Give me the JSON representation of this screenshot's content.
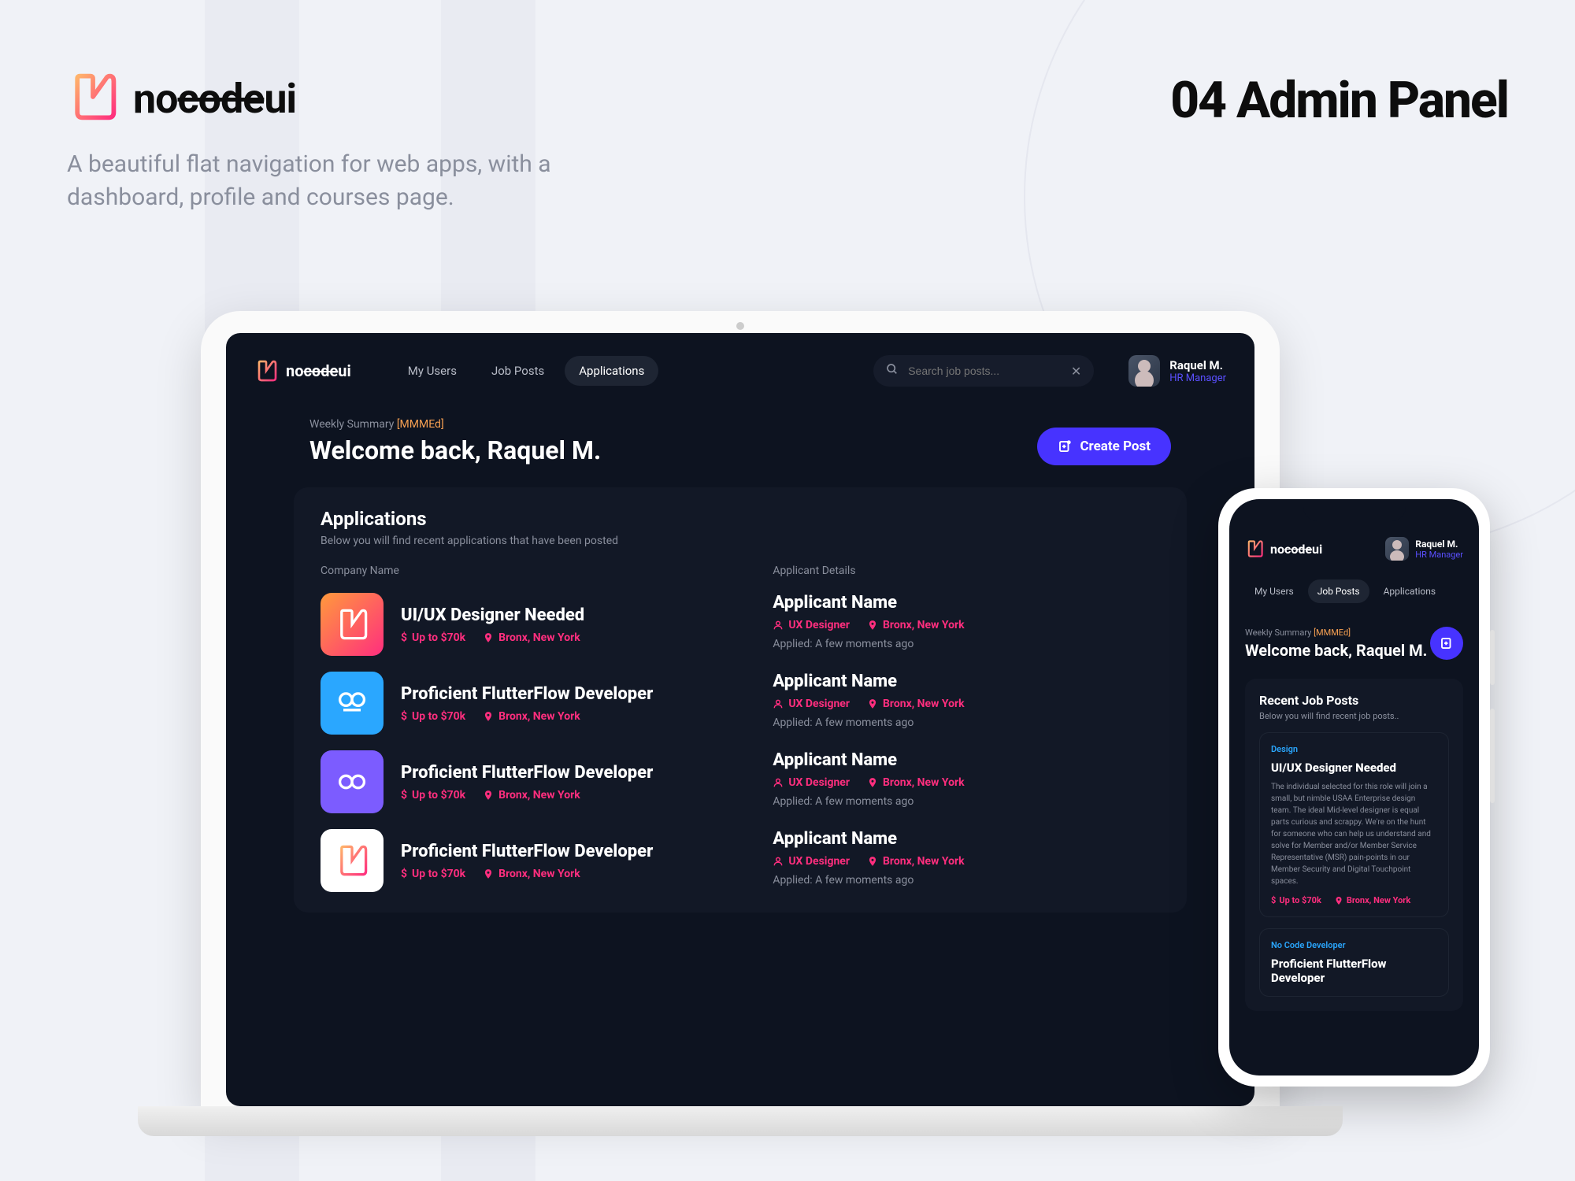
{
  "page": {
    "brand": "nocodeui",
    "tagline": "A beautiful flat navigation for web apps, with a dashboard, profile and courses page.",
    "big_title": "04 Admin Panel"
  },
  "laptop": {
    "brand": "nocodeui",
    "nav": [
      "My Users",
      "Job Posts",
      "Applications"
    ],
    "active_nav_index": 2,
    "search_placeholder": "Search job posts...",
    "user": {
      "name": "Raquel M.",
      "role": "HR Manager"
    },
    "summary_label": "Weekly Summary",
    "summary_tag": "[MMMEd]",
    "welcome": "Welcome back, Raquel M.",
    "create_btn": "Create Post",
    "panel": {
      "title": "Applications",
      "subtitle": "Below you will find recent applications that have been posted",
      "col_left": "Company Name",
      "col_right": "Applicant Details"
    },
    "rows": [
      {
        "tile": "gradient",
        "title": "UI/UX Designer Needed",
        "salary": "Up to $70k",
        "location": "Bronx, New York",
        "applicant_name": "Applicant Name",
        "app_role": "UX Designer",
        "app_location": "Bronx, New York",
        "applied": "Applied: A few moments ago"
      },
      {
        "tile": "blue",
        "title": "Proficient FlutterFlow Developer",
        "salary": "Up to $70k",
        "location": "Bronx, New York",
        "applicant_name": "Applicant Name",
        "app_role": "UX Designer",
        "app_location": "Bronx, New York",
        "applied": "Applied: A few moments ago"
      },
      {
        "tile": "purple",
        "title": "Proficient FlutterFlow Developer",
        "salary": "Up to $70k",
        "location": "Bronx, New York",
        "applicant_name": "Applicant Name",
        "app_role": "UX Designer",
        "app_location": "Bronx, New York",
        "applied": "Applied: A few moments ago"
      },
      {
        "tile": "white",
        "title": "Proficient FlutterFlow Developer",
        "salary": "Up to $70k",
        "location": "Bronx, New York",
        "applicant_name": "Applicant Name",
        "app_role": "UX Designer",
        "app_location": "Bronx, New York",
        "applied": "Applied: A few moments ago"
      }
    ]
  },
  "phone": {
    "brand": "nocodeui",
    "user": {
      "name": "Raquel M.",
      "role": "HR Manager"
    },
    "nav": [
      "My Users",
      "Job Posts",
      "Applications"
    ],
    "active_nav_index": 1,
    "summary_label": "Weekly Summary",
    "summary_tag": "[MMMEd]",
    "welcome": "Welcome back, Raquel M.",
    "panel": {
      "title": "Recent Job Posts",
      "subtitle": "Below you will find recent job posts.."
    },
    "card1": {
      "category": "Design",
      "title": "UI/UX Designer Needed",
      "desc": "The individual selected for this role will join a small, but nimble USAA Enterprise design team. The ideal Mid-level designer is equal parts curious and scrappy. We're on the hunt for someone who can help us understand and solve for Member and/or Member Service Representative (MSR) pain-points in our Member Security and Digital Touchpoint spaces.",
      "salary": "Up to $70k",
      "location": "Bronx, New York"
    },
    "card2": {
      "category": "No Code Developer",
      "title": "Proficient FlutterFlow Developer"
    }
  }
}
